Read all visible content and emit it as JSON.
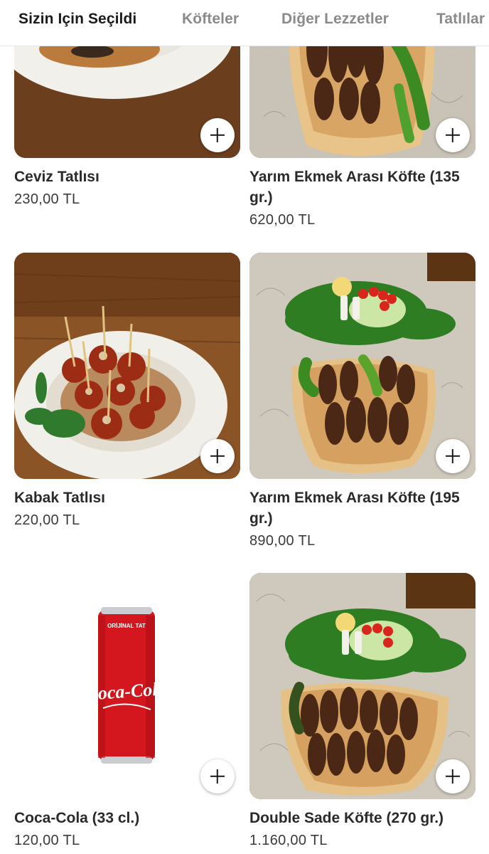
{
  "tabs": [
    {
      "label": "Sizin Için Seçildi",
      "active": true
    },
    {
      "label": "Köfteler",
      "active": false
    },
    {
      "label": "Diğer Lezzetler",
      "active": false
    },
    {
      "label": "Tatlılar",
      "active": false
    }
  ],
  "products": [
    {
      "name": "Ceviz Tatlısı",
      "price": "230,00 TL",
      "image": "walnut-dessert-plate"
    },
    {
      "name": "Yarım Ekmek Arası Köfte (135 gr.)",
      "price": "620,00 TL",
      "image": "meatball-sandwich"
    },
    {
      "name": "Kabak Tatlısı",
      "price": "220,00 TL",
      "image": "pumpkin-dessert-plate"
    },
    {
      "name": "Yarım Ekmek Arası Köfte (195 gr.)",
      "price": "890,00 TL",
      "image": "meatball-sandwich-salad"
    },
    {
      "name": "Coca-Cola (33 cl.)",
      "price": "120,00 TL",
      "image": "coca-cola-can"
    },
    {
      "name": "Double Sade Köfte (270 gr.)",
      "price": "1.160,00 TL",
      "image": "double-meatball-plate"
    }
  ],
  "can_text": {
    "top": "ORİJİNAL TAT",
    "logo": "Coca-Cola"
  },
  "add_button_icon": "plus-icon",
  "colors": {
    "active_tab": "#1a1a1a",
    "inactive_tab": "#8a8a8a",
    "coke_red": "#d4171e"
  }
}
